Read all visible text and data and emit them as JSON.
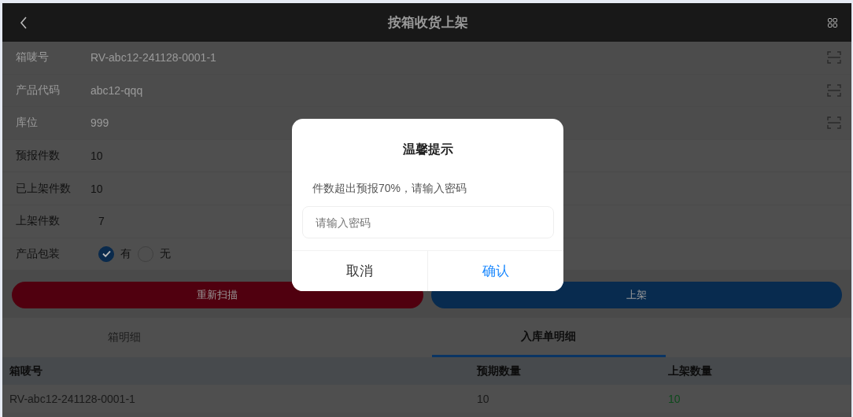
{
  "header": {
    "title": "按箱收货上架"
  },
  "fields": [
    {
      "label": "箱唛号",
      "value": "RV-abc12-241128-0001-1",
      "disabled": true,
      "kind": "scan"
    },
    {
      "label": "产品代码",
      "value": "abc12-qqq",
      "disabled": true,
      "kind": "scan"
    },
    {
      "label": "库位",
      "value": "999",
      "disabled": true,
      "kind": "scan"
    },
    {
      "label": "预报件数",
      "value": "10",
      "disabled": false,
      "kind": "text"
    },
    {
      "label": "已上架件数",
      "value": "10",
      "disabled": false,
      "kind": "text"
    },
    {
      "label": "上架件数",
      "value": "7",
      "disabled": false,
      "kind": "input"
    },
    {
      "label": "产品包装",
      "kind": "radio",
      "options": [
        {
          "label": "有",
          "selected": true
        },
        {
          "label": "无",
          "selected": false
        }
      ]
    }
  ],
  "buttons": [
    {
      "label": "重新扫描",
      "kind": "danger"
    },
    {
      "label": "上架",
      "kind": "primary"
    }
  ],
  "tabs": [
    {
      "label": "箱明细",
      "selected": false
    },
    {
      "label": "入库单明细",
      "selected": true
    }
  ],
  "table": {
    "columns": [
      "箱唛号",
      "预期数量",
      "上架数量"
    ],
    "rows": [
      {
        "cells": [
          {
            "text": "RV-abc12-241128-0001-1"
          },
          {
            "text": "10"
          },
          {
            "text": "10",
            "color": "#0e4a1c"
          }
        ]
      }
    ]
  },
  "dialog": {
    "title": "温馨提示",
    "message": "件数超出预报70%，请输入密码",
    "input": {
      "placeholder": "请输入密码"
    },
    "buttons": [
      {
        "label": "取消",
        "kind": "cancel"
      },
      {
        "label": "确认",
        "kind": "confirm"
      }
    ]
  }
}
